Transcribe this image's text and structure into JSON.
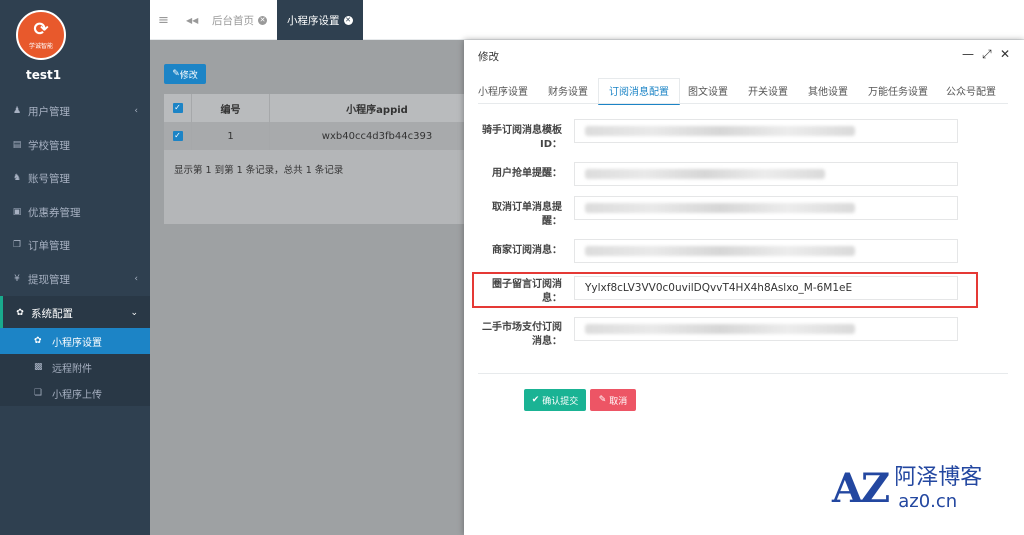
{
  "sidebar": {
    "logo_text": "学诚智能",
    "user": "test1",
    "items": [
      {
        "label": "用户管理",
        "icon": "user-icon",
        "arrow": "‹"
      },
      {
        "label": "学校管理",
        "icon": "school-icon",
        "arrow": ""
      },
      {
        "label": "账号管理",
        "icon": "users-icon",
        "arrow": ""
      },
      {
        "label": "优惠券管理",
        "icon": "coupon-icon",
        "arrow": ""
      },
      {
        "label": "订单管理",
        "icon": "order-icon",
        "arrow": ""
      },
      {
        "label": "提现管理",
        "icon": "yen-icon",
        "arrow": "‹"
      },
      {
        "label": "系统配置",
        "icon": "gear-icon",
        "arrow": "⌄"
      }
    ],
    "subitems": [
      {
        "label": "小程序设置",
        "icon": "gear-icon"
      },
      {
        "label": "远程附件",
        "icon": "image-icon"
      },
      {
        "label": "小程序上传",
        "icon": "copy-icon"
      }
    ]
  },
  "topbar": {
    "menu_icon": "≡",
    "back_icon": "◀◀",
    "tabs": [
      {
        "label": "后台首页"
      },
      {
        "label": "小程序设置"
      }
    ]
  },
  "main": {
    "edit_button": "修改",
    "table": {
      "headers": [
        "编号",
        "小程序appid"
      ],
      "rows": [
        [
          "1",
          "wxb40cc4d3fb44c393"
        ]
      ],
      "footer": "显示第 1 到第 1 条记录，总共 1 条记录"
    }
  },
  "modal": {
    "title": "修改",
    "controls": [
      "—",
      "⤢",
      "✕"
    ],
    "tabs": [
      "小程序设置",
      "财务设置",
      "订阅消息配置",
      "图文设置",
      "开关设置",
      "其他设置",
      "万能任务设置",
      "公众号配置"
    ],
    "active_tab": "订阅消息配置",
    "fields": [
      {
        "label": "骑手订阅消息模板ID：",
        "value": ""
      },
      {
        "label": "用户抢单提醒：",
        "value": ""
      },
      {
        "label": "取消订单消息提醒：",
        "value": ""
      },
      {
        "label": "商家订阅消息：",
        "value": ""
      },
      {
        "label": "圈子留言订阅消息：",
        "value": "Yylxf8cLV3VV0c0uvilDQvvT4HX4h8Aslxo_M-6M1eE"
      },
      {
        "label": "二手市场支付订阅消息：",
        "value": ""
      }
    ],
    "confirm": "确认提交",
    "cancel": "取消"
  },
  "watermark": {
    "logo": "AZ",
    "name": "阿泽博客",
    "domain": "az0.cn"
  },
  "colors": {
    "sidebar": "#2f4050",
    "accent": "#1c84c6",
    "confirm": "#1ab394",
    "cancel": "#ed5565",
    "highlight": "#e53935"
  }
}
